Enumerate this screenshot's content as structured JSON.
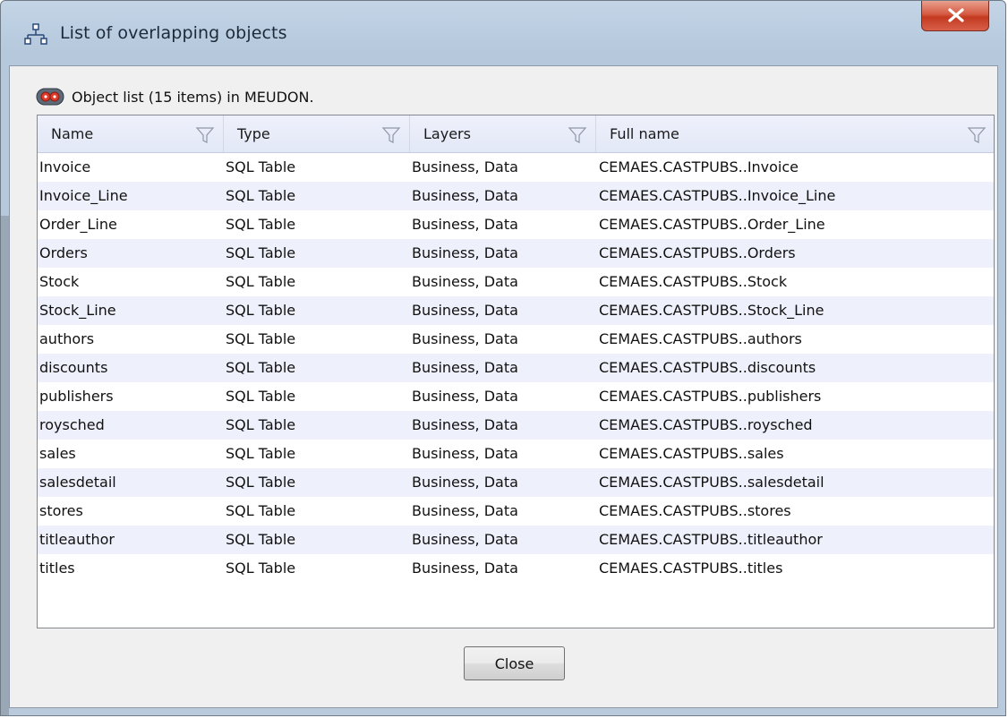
{
  "window": {
    "title": "List of overlapping objects"
  },
  "list": {
    "caption": "Object list (15 items) in MEUDON."
  },
  "table": {
    "columns": [
      "Name",
      "Type",
      "Layers",
      "Full name"
    ],
    "rows": [
      [
        "Invoice",
        "SQL Table",
        "Business, Data",
        "CEMAES.CASTPUBS..Invoice"
      ],
      [
        "Invoice_Line",
        "SQL Table",
        "Business, Data",
        "CEMAES.CASTPUBS..Invoice_Line"
      ],
      [
        "Order_Line",
        "SQL Table",
        "Business, Data",
        "CEMAES.CASTPUBS..Order_Line"
      ],
      [
        "Orders",
        "SQL Table",
        "Business, Data",
        "CEMAES.CASTPUBS..Orders"
      ],
      [
        "Stock",
        "SQL Table",
        "Business, Data",
        "CEMAES.CASTPUBS..Stock"
      ],
      [
        "Stock_Line",
        "SQL Table",
        "Business, Data",
        "CEMAES.CASTPUBS..Stock_Line"
      ],
      [
        "authors",
        "SQL Table",
        "Business, Data",
        "CEMAES.CASTPUBS..authors"
      ],
      [
        "discounts",
        "SQL Table",
        "Business, Data",
        "CEMAES.CASTPUBS..discounts"
      ],
      [
        "publishers",
        "SQL Table",
        "Business, Data",
        "CEMAES.CASTPUBS..publishers"
      ],
      [
        "roysched",
        "SQL Table",
        "Business, Data",
        "CEMAES.CASTPUBS..roysched"
      ],
      [
        "sales",
        "SQL Table",
        "Business, Data",
        "CEMAES.CASTPUBS..sales"
      ],
      [
        "salesdetail",
        "SQL Table",
        "Business, Data",
        "CEMAES.CASTPUBS..salesdetail"
      ],
      [
        "stores",
        "SQL Table",
        "Business, Data",
        "CEMAES.CASTPUBS..stores"
      ],
      [
        "titleauthor",
        "SQL Table",
        "Business, Data",
        "CEMAES.CASTPUBS..titleauthor"
      ],
      [
        "titles",
        "SQL Table",
        "Business, Data",
        "CEMAES.CASTPUBS..titles"
      ]
    ]
  },
  "buttons": {
    "close_label": "Close"
  },
  "icons": {
    "title": "hierarchy-icon",
    "caption": "object-list-icon",
    "filter": "filter-icon",
    "window_close": "close-icon"
  },
  "colors": {
    "header_bg": "#e3e8f7",
    "alt_row_bg": "#eef1fb",
    "close_red": "#c2391f"
  }
}
